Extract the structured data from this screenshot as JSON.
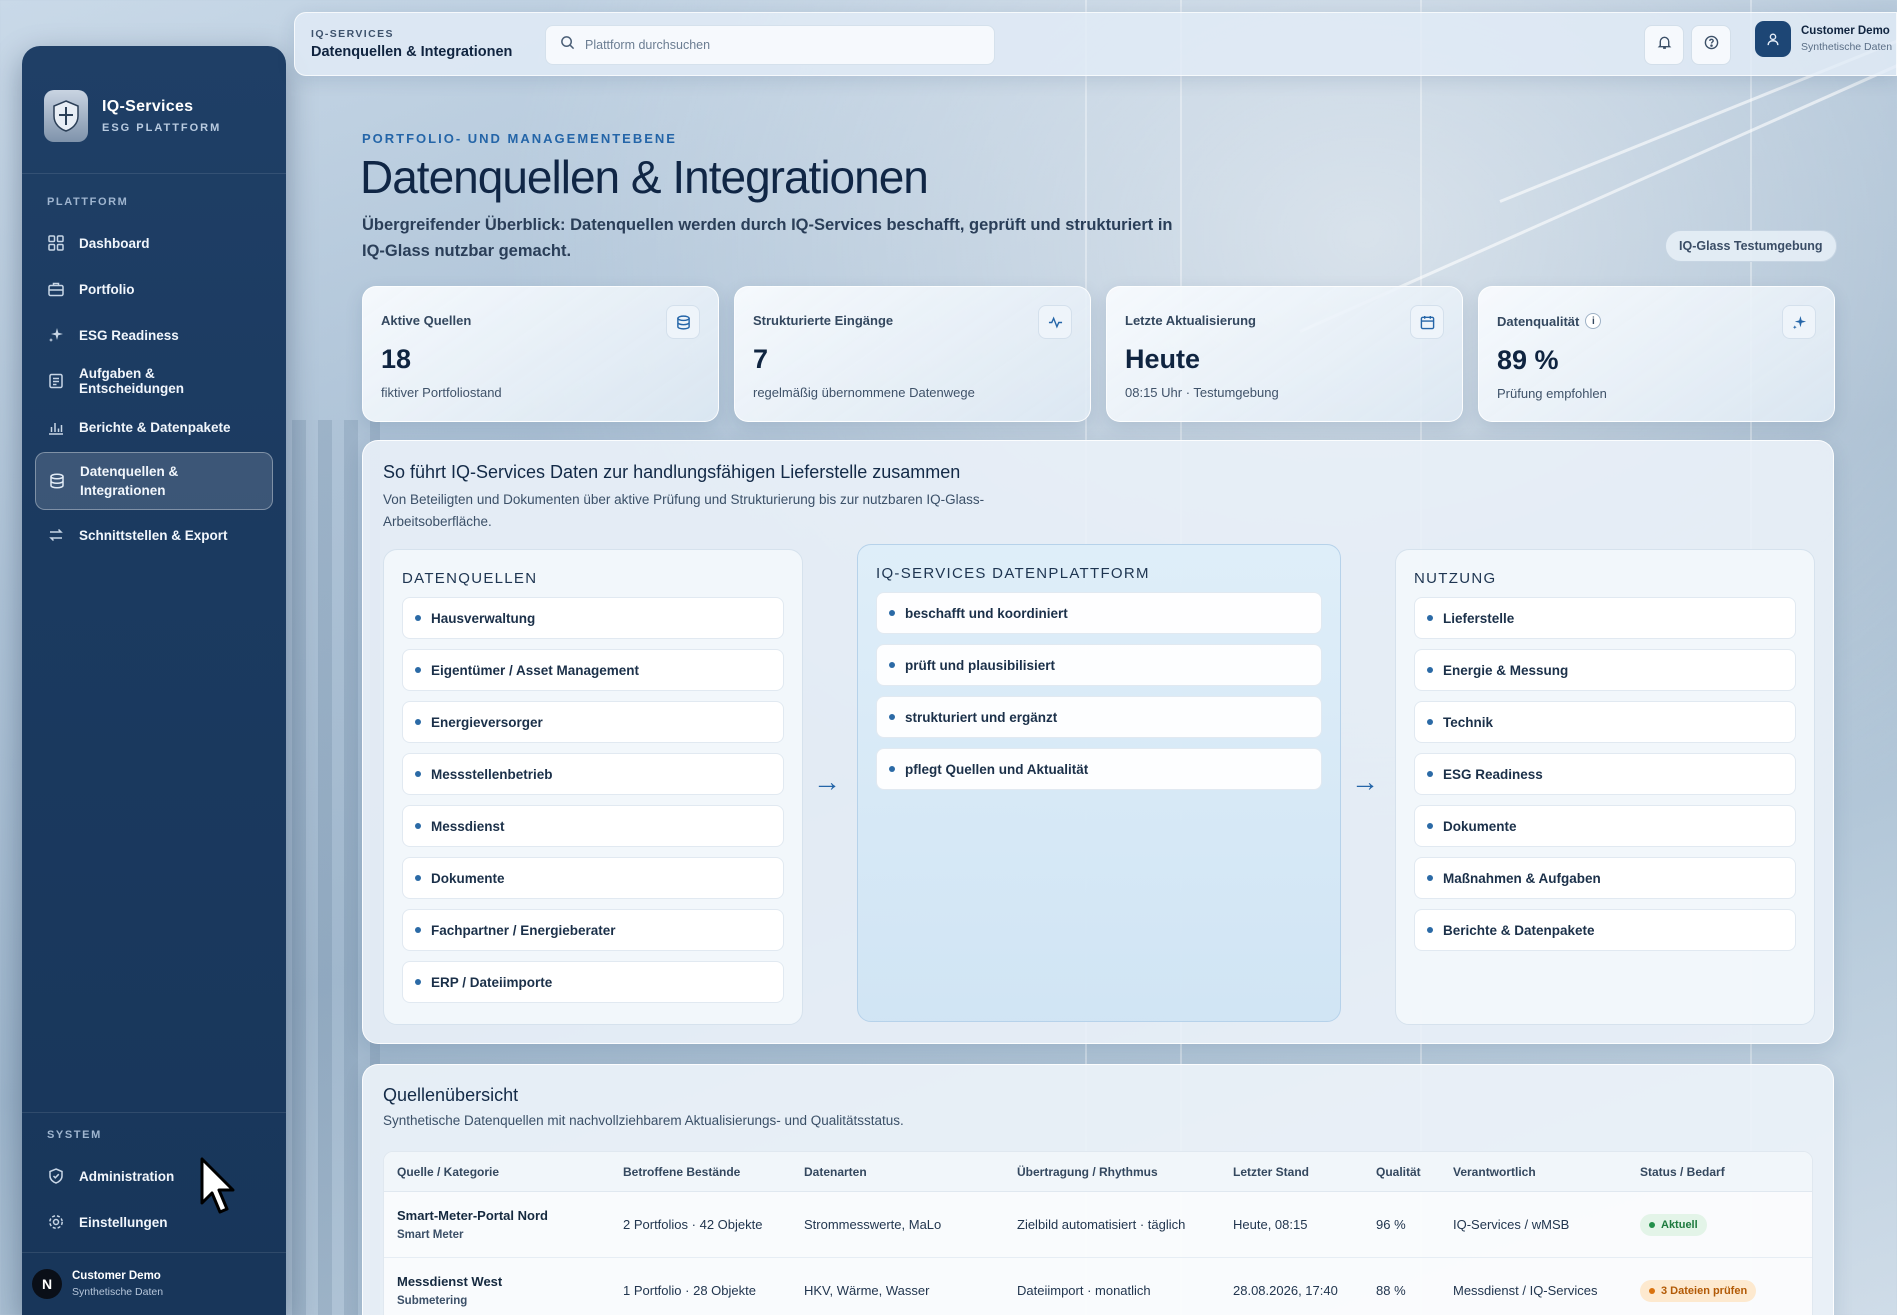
{
  "sidebar": {
    "brand_name": "IQ-Services",
    "brand_sub": "ESG PLATTFORM",
    "section_platform": "PLATTFORM",
    "items": [
      {
        "label": "Dashboard",
        "icon": "grid-icon"
      },
      {
        "label": "Portfolio",
        "icon": "briefcase-icon"
      },
      {
        "label": "ESG Readiness",
        "icon": "sparkle-icon"
      },
      {
        "label": "Aufgaben & Entscheidungen",
        "icon": "clipboard-icon"
      },
      {
        "label": "Berichte & Datenpakete",
        "icon": "bar-chart-icon"
      },
      {
        "label": "Datenquellen & Integrationen",
        "icon": "database-icon",
        "active": true
      },
      {
        "label": "Schnittstellen & Export",
        "icon": "swap-arrows-icon"
      }
    ],
    "section_system": "SYSTEM",
    "system_items": [
      {
        "label": "Administration",
        "icon": "shield-check-icon"
      },
      {
        "label": "Einstellungen",
        "icon": "gear-icon"
      }
    ],
    "user": {
      "initial": "N",
      "name": "Customer Demo",
      "sub": "Synthetische Daten"
    }
  },
  "topbar": {
    "kicker": "IQ-SERVICES",
    "title": "Datenquellen & Integrationen",
    "search_placeholder": "Plattform durchsuchen",
    "user_name": "Customer Demo",
    "user_sub": "Synthetische Daten"
  },
  "header": {
    "eyebrow": "PORTFOLIO- UND MANAGEMENTEBENE",
    "title": "Datenquellen & Integrationen",
    "lead": "Übergreifender Überblick: Datenquellen werden durch IQ-Services beschafft, geprüft und strukturiert in IQ-Glass nutzbar gemacht.",
    "env_chip": "IQ-Glass Testumgebung"
  },
  "kpis": [
    {
      "label": "Aktive Quellen",
      "value": "18",
      "sub": "fiktiver Portfoliostand",
      "icon": "database-icon"
    },
    {
      "label": "Strukturierte Eingänge",
      "value": "7",
      "sub": "regelmäßig übernommene Datenwege",
      "icon": "activity-icon"
    },
    {
      "label": "Letzte Aktualisierung",
      "value": "Heute",
      "sub": "08:15 Uhr · Testumgebung",
      "icon": "calendar-icon"
    },
    {
      "label": "Datenqualität",
      "value": "89 %",
      "sub": "Prüfung empfohlen",
      "icon": "sparkle-icon",
      "info": "i"
    }
  ],
  "flow": {
    "title": "So führt IQ-Services Daten zur handlungsfähigen Lieferstelle zusammen",
    "desc": "Von Beteiligten und Dokumenten über aktive Prüfung und Strukturierung bis zur nutzbaren IQ-Glass-Arbeitsoberfläche.",
    "sources_title": "DATENQUELLEN",
    "sources": [
      "Hausverwaltung",
      "Eigentümer / Asset Management",
      "Energieversorger",
      "Messstellenbetrieb",
      "Messdienst",
      "Dokumente",
      "Fachpartner / Energieberater",
      "ERP / Dateiimporte"
    ],
    "platform_title": "IQ-SERVICES DATENPLATTFORM",
    "platform": [
      "beschafft und koordiniert",
      "prüft und plausibilisiert",
      "strukturiert und ergänzt",
      "pflegt Quellen und Aktualität"
    ],
    "usage_title": "NUTZUNG",
    "usage": [
      "Lieferstelle",
      "Energie & Messung",
      "Technik",
      "ESG Readiness",
      "Dokumente",
      "Maßnahmen & Aufgaben",
      "Berichte & Datenpakete"
    ],
    "arrow": "→"
  },
  "sources_table": {
    "title": "Quellenübersicht",
    "desc": "Synthetische Datenquellen mit nachvollziehbarem Aktualisierungs- und Qualitätsstatus.",
    "columns": [
      "Quelle / Kategorie",
      "Betroffene Bestände",
      "Datenarten",
      "Übertragung / Rhythmus",
      "Letzter Stand",
      "Qualität",
      "Verantwortlich",
      "Status / Bedarf"
    ],
    "rows": [
      {
        "name": "Smart-Meter-Portal Nord",
        "category": "Smart Meter",
        "assets": "2 Portfolios · 42 Objekte",
        "types": "Strommesswerte, MaLo",
        "transfer": "Zielbild automatisiert · täglich",
        "last": "Heute, 08:15",
        "quality": "96 %",
        "owner": "IQ-Services / wMSB",
        "status": "Aktuell",
        "status_color": "#22904a"
      },
      {
        "name": "Messdienst West",
        "category": "Submetering",
        "assets": "1 Portfolio · 28 Objekte",
        "types": "HKV, Wärme, Wasser",
        "transfer": "Dateiimport · monatlich",
        "last": "28.08.2026, 17:40",
        "quality": "88 %",
        "owner": "Messdienst / IQ-Services",
        "status": "3 Dateien prüfen",
        "status_color": "#d9720f"
      }
    ]
  }
}
